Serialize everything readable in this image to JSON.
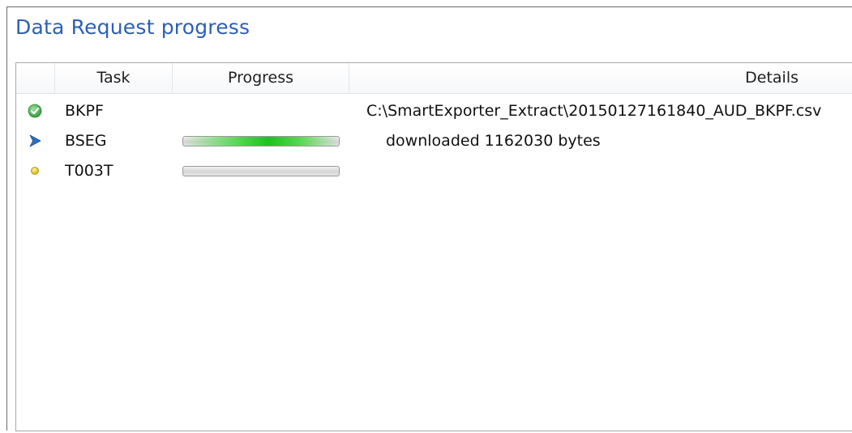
{
  "window": {
    "title": "Data Request progress"
  },
  "columns": {
    "task": "Task",
    "progress": "Progress",
    "details": "Details"
  },
  "rows": [
    {
      "status": "completed",
      "status_icon": "check-circle-icon",
      "task": "BKPF",
      "progress_visible": false,
      "progress_fraction": null,
      "details": "C:\\SmartExporter_Extract\\20150127161840_AUD_BKPF.csv"
    },
    {
      "status": "running",
      "status_icon": "play-arrow-icon",
      "task": "BSEG",
      "progress_visible": true,
      "progress_fraction": 0.5,
      "details": "downloaded 1162030 bytes"
    },
    {
      "status": "pending",
      "status_icon": "yellow-dot-icon",
      "task": "T003T",
      "progress_visible": true,
      "progress_fraction": 0,
      "details": ""
    }
  ],
  "colors": {
    "title": "#2d5fb4",
    "completed": "#3fae49",
    "running": "#2f6fbf",
    "pending": "#e3c21a",
    "progress_fill": "#1fbf22"
  }
}
